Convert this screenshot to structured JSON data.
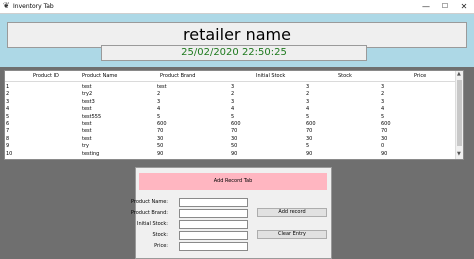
{
  "window": {
    "title": "Inventory Tab",
    "icon": "feather-icon",
    "minimize": "—",
    "maximize": "☐",
    "close": "✕"
  },
  "header": {
    "retailer_name": "retailer name",
    "datetime": "25/02/2020 22:50:25"
  },
  "table": {
    "columns": [
      "Product ID",
      "Product Name",
      "Product Brand",
      "Initial Stock",
      "Stock",
      "Price"
    ],
    "rows": [
      [
        "1",
        "test",
        "test",
        "3",
        "3",
        "3"
      ],
      [
        "2",
        "try2",
        "2",
        "2",
        "2",
        "2"
      ],
      [
        "3",
        "test3",
        "3",
        "3",
        "3",
        "3"
      ],
      [
        "4",
        "test",
        "4",
        "4",
        "4",
        "4"
      ],
      [
        "5",
        "test555",
        "5",
        "5",
        "5",
        "5"
      ],
      [
        "6",
        "test",
        "600",
        "600",
        "600",
        "600"
      ],
      [
        "7",
        "test",
        "70",
        "70",
        "70",
        "70"
      ],
      [
        "8",
        "test",
        "30",
        "30",
        "30",
        "30"
      ],
      [
        "9",
        "try",
        "50",
        "50",
        "5",
        "0"
      ],
      [
        "10",
        "testing",
        "90",
        "90",
        "90",
        "90"
      ]
    ]
  },
  "form": {
    "title": "Add Record Tab",
    "labels": {
      "name": "Product Name:",
      "brand": "Product Brand:",
      "initial_stock": "Initial Stock:",
      "stock": "Stock:",
      "price": "Price:"
    },
    "values": {
      "name": "",
      "brand": "",
      "initial_stock": "",
      "stock": "",
      "price": ""
    },
    "add_button": "Add record",
    "clear_button": "Clear Entry"
  },
  "colors": {
    "header_bg": "#add8e6",
    "datetime_text": "#1e7a1e",
    "form_header_bg": "#ffb6c1",
    "background": "#6f6f6f"
  }
}
